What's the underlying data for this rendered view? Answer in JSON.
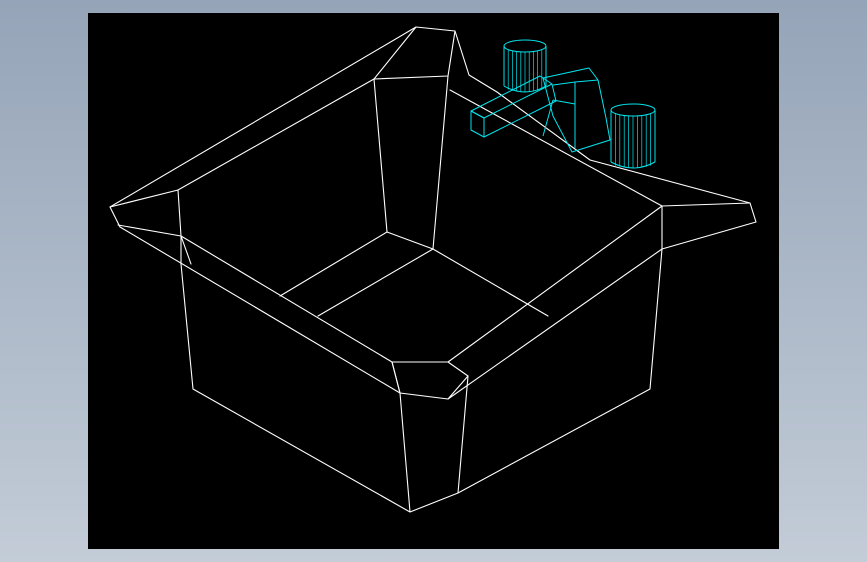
{
  "colors": {
    "background": "#9fb0c3",
    "viewport": "#000000",
    "sink_lines": "#ffffff",
    "faucet_lines": "#00e5ee"
  },
  "viewport": {
    "content": "wireframe-3d-sink-with-faucet"
  }
}
